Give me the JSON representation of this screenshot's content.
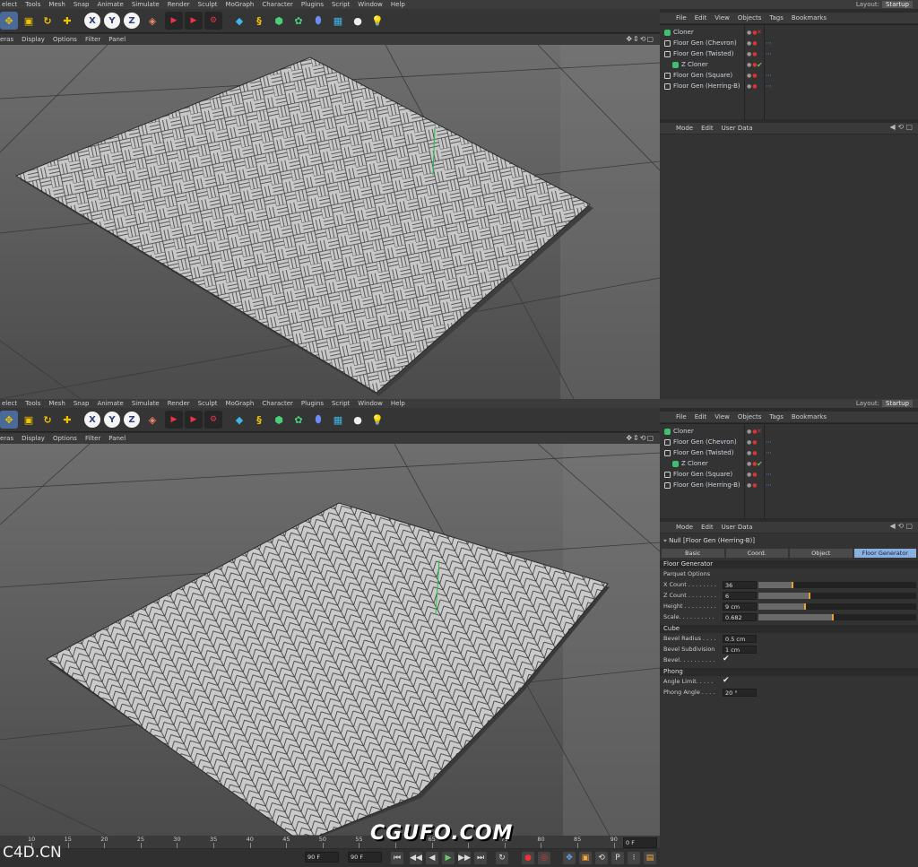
{
  "menu": [
    "elect",
    "Tools",
    "Mesh",
    "Snap",
    "Animate",
    "Simulate",
    "Render",
    "Sculpt",
    "MoGraph",
    "Character",
    "Plugins",
    "Script",
    "Window",
    "Help"
  ],
  "layout": {
    "label": "Layout:",
    "value": "Startup"
  },
  "view_menu": [
    "eras",
    "Display",
    "Options",
    "Filter",
    "Panel"
  ],
  "axes": [
    "X",
    "Y",
    "Z"
  ],
  "om_menu": [
    "File",
    "Edit",
    "View",
    "Objects",
    "Tags",
    "Bookmarks"
  ],
  "objects": [
    {
      "name": "Cloner",
      "type": "cloner"
    },
    {
      "name": "Floor Gen (Chevron)",
      "type": "null"
    },
    {
      "name": "Floor Gen (Twisted)",
      "type": "null"
    },
    {
      "name": "Z Cloner",
      "type": "cloner"
    },
    {
      "name": "Floor Gen (Square)",
      "type": "null"
    },
    {
      "name": "Floor Gen (Herring-B)",
      "type": "null"
    }
  ],
  "am_menu": [
    "Mode",
    "Edit",
    "User Data"
  ],
  "attr": {
    "title": "Null [Floor Gen (Herring-B)]",
    "tabs": [
      "Basic",
      "Coord.",
      "Object",
      "Floor Generator"
    ],
    "group": "Floor Generator",
    "parquet": "Parquet Options",
    "params": [
      {
        "label": "X Count . . . . . . . .",
        "value": "36",
        "fill": 0.22
      },
      {
        "label": "Z Count . . . . . . . .",
        "value": "6",
        "fill": 0.33
      },
      {
        "label": "Height . . . . . . . . .",
        "value": "9 cm",
        "fill": 0.3
      },
      {
        "label": "Scale. . . . . . . . . .",
        "value": "0.682",
        "fill": 0.48
      }
    ],
    "cube": "Cube",
    "cube_params": [
      {
        "label": "Bevel Radius . . . .",
        "value": "0.5 cm"
      },
      {
        "label": "Bevel Subdivision",
        "value": "1 cm"
      }
    ],
    "bevel_label": "Bevel. . . . . . . . . .",
    "phong": "Phong",
    "angle_limit_label": "Angle Limit. . . . .",
    "phong_angle": {
      "label": "Phong Angle . . . .",
      "value": "20 °"
    }
  },
  "timeline": {
    "ticks": [
      "10",
      "15",
      "20",
      "25",
      "30",
      "35",
      "40",
      "45",
      "50",
      "55",
      "60",
      "65",
      "70",
      "75",
      "80",
      "85",
      "90"
    ],
    "frame_end": "90 F",
    "frame_field": "90 F",
    "current": "0 F"
  },
  "watermark": "CGUFO.COM",
  "brand": "C4D.CN"
}
